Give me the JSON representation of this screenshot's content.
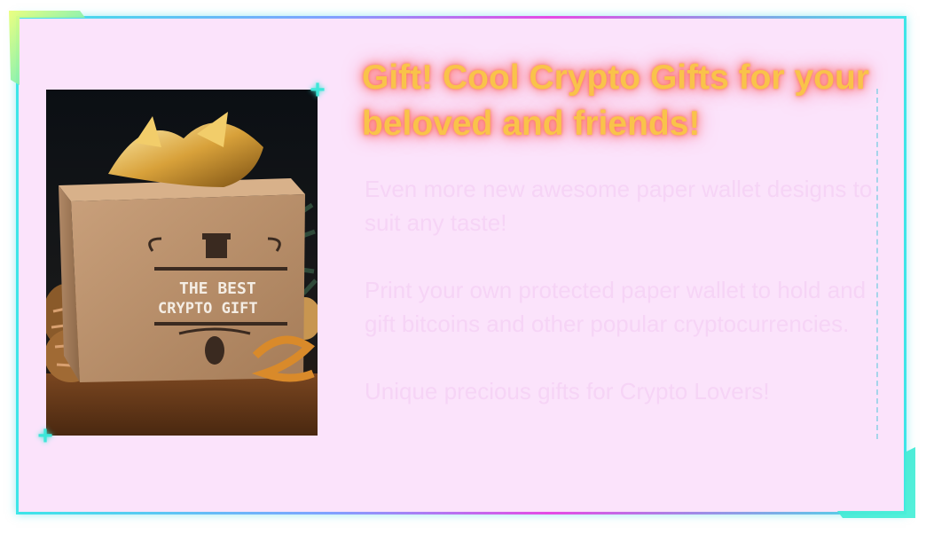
{
  "card": {
    "title": "Gift! Cool Crypto Gifts for your beloved and friends!",
    "paragraphs": [
      "Even more new awesome paper wallet designs to suit any taste!",
      "Print your own protected paper wallet to hold and gift bitcoins and other popular cryptocurrencies.",
      "Unique precious gifts for Crypto Lovers!"
    ],
    "image": {
      "box_text_line1": "THE BEST",
      "box_text_line2": "CRYPTO GIFT"
    }
  },
  "colors": {
    "panel_bg": "#fbe3fb",
    "title": "#f9c34a",
    "title_glow": "#ff6a5a",
    "body_text": "#f6d4f6",
    "accent_cyan": "#3ee6d8",
    "accent_magenta": "#e64be4"
  },
  "icons": [
    "plus-icon",
    "corner-bracket-icon",
    "gift-icon",
    "pinecone-icon"
  ]
}
